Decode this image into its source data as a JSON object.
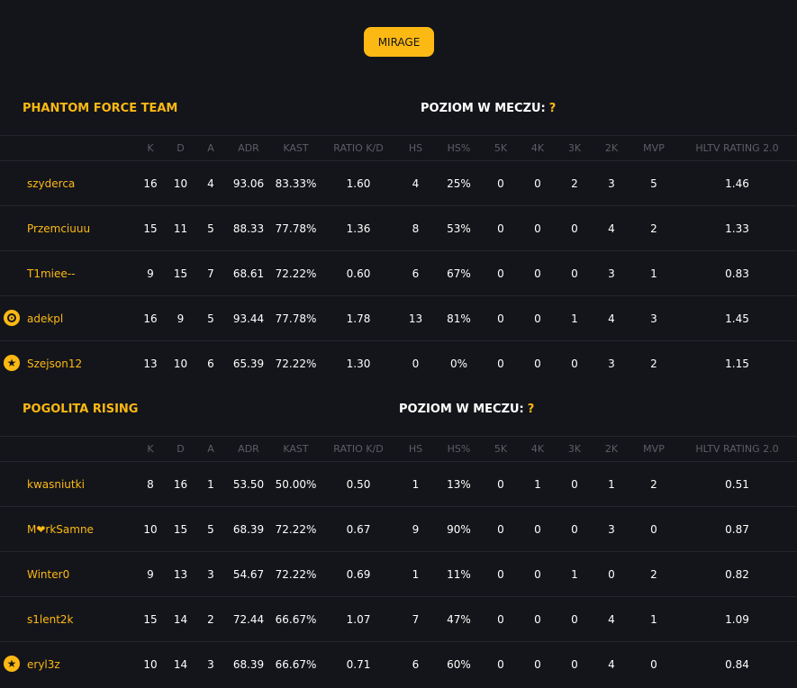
{
  "map": {
    "label": "MIRAGE"
  },
  "level_label": "POZIOM W MECZU:",
  "level_value": "?",
  "columns": [
    "K",
    "D",
    "A",
    "ADR",
    "KAST",
    "RATIO K/D",
    "HS",
    "HS%",
    "5K",
    "4K",
    "3K",
    "2K",
    "MVP",
    "HLTV RATING 2.0"
  ],
  "teams": [
    {
      "name": "PHANTOM FORCE TEAM",
      "players": [
        {
          "name": "szyderca",
          "badge": "",
          "stats": [
            "16",
            "10",
            "4",
            "93.06",
            "83.33%",
            "1.60",
            "4",
            "25%",
            "0",
            "0",
            "2",
            "3",
            "5",
            "1.46"
          ]
        },
        {
          "name": "Przemciuuu",
          "badge": "",
          "stats": [
            "15",
            "11",
            "5",
            "88.33",
            "77.78%",
            "1.36",
            "8",
            "53%",
            "0",
            "0",
            "0",
            "4",
            "2",
            "1.33"
          ]
        },
        {
          "name": "T1miee--",
          "badge": "",
          "stats": [
            "9",
            "15",
            "7",
            "68.61",
            "72.22%",
            "0.60",
            "6",
            "67%",
            "0",
            "0",
            "0",
            "3",
            "1",
            "0.83"
          ]
        },
        {
          "name": "adekpl",
          "badge": "target-icon",
          "stats": [
            "16",
            "9",
            "5",
            "93.44",
            "77.78%",
            "1.78",
            "13",
            "81%",
            "0",
            "0",
            "1",
            "4",
            "3",
            "1.45"
          ]
        },
        {
          "name": "Szejson12",
          "badge": "star-icon",
          "stats": [
            "13",
            "10",
            "6",
            "65.39",
            "72.22%",
            "1.30",
            "0",
            "0%",
            "0",
            "0",
            "0",
            "3",
            "2",
            "1.15"
          ]
        }
      ]
    },
    {
      "name": "POGOLITA RISING",
      "players": [
        {
          "name": "kwasniutki",
          "badge": "",
          "stats": [
            "8",
            "16",
            "1",
            "53.50",
            "50.00%",
            "0.50",
            "1",
            "13%",
            "0",
            "1",
            "0",
            "1",
            "2",
            "0.51"
          ]
        },
        {
          "name": "M❤rkSamne",
          "badge": "",
          "stats": [
            "10",
            "15",
            "5",
            "68.39",
            "72.22%",
            "0.67",
            "9",
            "90%",
            "0",
            "0",
            "0",
            "3",
            "0",
            "0.87"
          ]
        },
        {
          "name": "Winter0",
          "badge": "",
          "stats": [
            "9",
            "13",
            "3",
            "54.67",
            "72.22%",
            "0.69",
            "1",
            "11%",
            "0",
            "0",
            "1",
            "0",
            "2",
            "0.82"
          ]
        },
        {
          "name": "s1lent2k",
          "badge": "",
          "stats": [
            "15",
            "14",
            "2",
            "72.44",
            "66.67%",
            "1.07",
            "7",
            "47%",
            "0",
            "0",
            "0",
            "4",
            "1",
            "1.09"
          ]
        },
        {
          "name": "eryl3z",
          "badge": "star-icon",
          "stats": [
            "10",
            "14",
            "3",
            "68.39",
            "66.67%",
            "0.71",
            "6",
            "60%",
            "0",
            "0",
            "0",
            "4",
            "0",
            "0.84"
          ]
        }
      ]
    }
  ]
}
